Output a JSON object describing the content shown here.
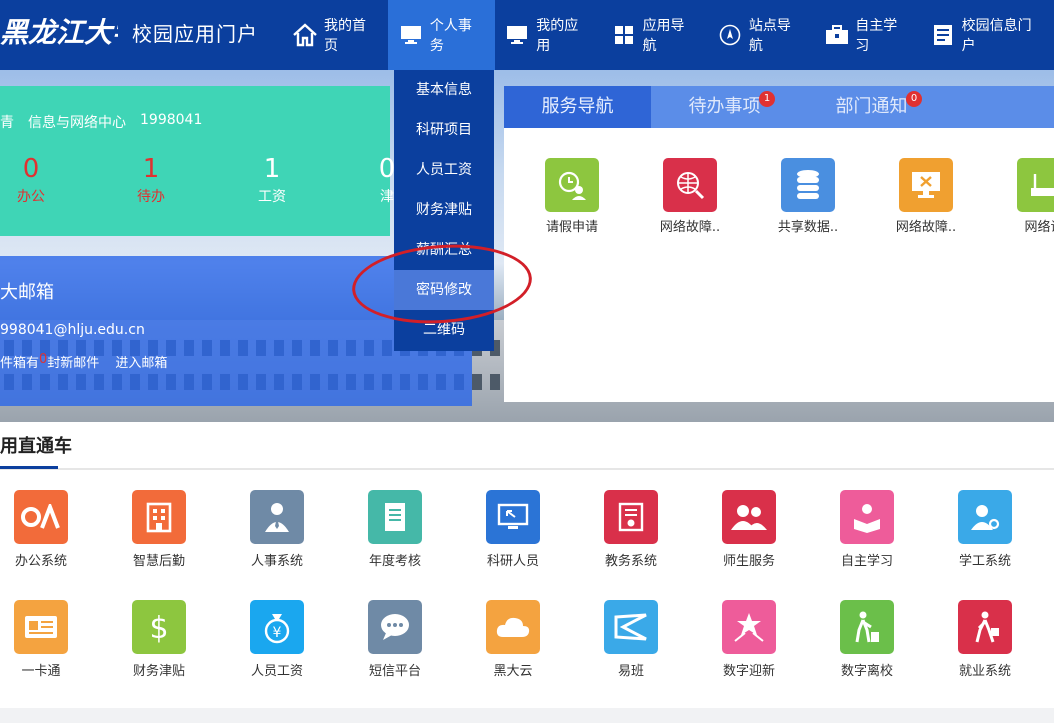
{
  "header": {
    "logo_text": "黑龙江大学",
    "portal_title": "校园应用门户",
    "nav": [
      {
        "label": "我的首页",
        "icon": "home-icon"
      },
      {
        "label": "个人事务",
        "icon": "monitor-icon"
      },
      {
        "label": "我的应用",
        "icon": "monitor-icon"
      },
      {
        "label": "应用导航",
        "icon": "grid-icon"
      },
      {
        "label": "站点导航",
        "icon": "compass-icon"
      },
      {
        "label": "自主学习",
        "icon": "briefcase-icon"
      },
      {
        "label": "校园信息门户",
        "icon": "document-icon"
      }
    ]
  },
  "dropdown": {
    "items": [
      "基本信息",
      "科研项目",
      "人员工资",
      "财务津贴",
      "薪酬汇总",
      "密码修改",
      "二维码"
    ]
  },
  "user": {
    "name_fragment": "青",
    "department": "信息与网络中心",
    "id": "1998041",
    "stats": [
      {
        "value": "0",
        "label": "办公"
      },
      {
        "value": "1",
        "label": "待办"
      },
      {
        "value": "1",
        "label": "工资"
      },
      {
        "value": "0",
        "label": "津"
      }
    ]
  },
  "mail": {
    "title": "大邮箱",
    "address": "998041@hlju.edu.cn",
    "prefix": "件箱有",
    "count": "0",
    "suffix": "封新邮件",
    "enter": "进入邮箱"
  },
  "service": {
    "tabs": [
      {
        "label": "服务导航",
        "badge": ""
      },
      {
        "label": "待办事项",
        "badge": "1"
      },
      {
        "label": "部门通知",
        "badge": "0"
      }
    ],
    "apps": [
      {
        "label": "请假申请",
        "color": "#8dc63f"
      },
      {
        "label": "网络故障..",
        "color": "#d9304a"
      },
      {
        "label": "共享数据..",
        "color": "#4a8fe0"
      },
      {
        "label": "网络故障..",
        "color": "#f0a030"
      },
      {
        "label": "网络设",
        "color": "#8dc63f"
      }
    ]
  },
  "apps_section": {
    "title": "用直通车",
    "row1": [
      {
        "label": "办公系统",
        "color": "#f26b3a"
      },
      {
        "label": "智慧后勤",
        "color": "#f26b3a"
      },
      {
        "label": "人事系统",
        "color": "#6f8aa6"
      },
      {
        "label": "年度考核",
        "color": "#45b8a8"
      },
      {
        "label": "科研人员",
        "color": "#2b74d6"
      },
      {
        "label": "教务系统",
        "color": "#d9304a"
      },
      {
        "label": "师生服务",
        "color": "#d9304a"
      },
      {
        "label": "自主学习",
        "color": "#ee5c9a"
      },
      {
        "label": "学工系统",
        "color": "#3aa9e8"
      }
    ],
    "row2": [
      {
        "label": "一卡通",
        "color": "#f4a340"
      },
      {
        "label": "财务津贴",
        "color": "#8dc63f"
      },
      {
        "label": "人员工资",
        "color": "#1aa7ef"
      },
      {
        "label": "短信平台",
        "color": "#6f8aa6"
      },
      {
        "label": "黑大云",
        "color": "#f4a340"
      },
      {
        "label": "易班",
        "color": "#3aa9e8"
      },
      {
        "label": "数字迎新",
        "color": "#ee5c9a"
      },
      {
        "label": "数字离校",
        "color": "#6bbf4a"
      },
      {
        "label": "就业系统",
        "color": "#d9304a"
      }
    ]
  },
  "accent": "#0b3f9e"
}
